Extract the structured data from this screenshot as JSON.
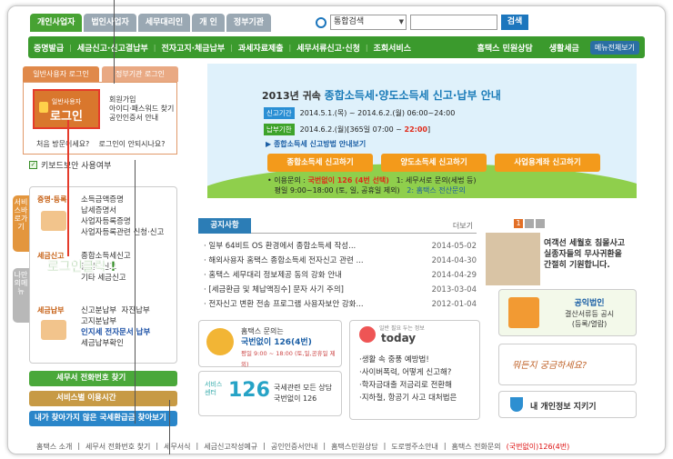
{
  "tabs": [
    "개인사업자",
    "법인사업자",
    "세무대리인",
    "개 인",
    "정부기관"
  ],
  "search": {
    "select": "통합검색",
    "button": "검색"
  },
  "nav": {
    "items": [
      "증명발급",
      "세금신고·신고결납부",
      "전자고지·체금납부",
      "과세자료제출",
      "세무서류신고·신청",
      "조회서비스"
    ],
    "right1": "홈택스 민원상담",
    "right2": "생활세금",
    "menu": "메뉴전체보기"
  },
  "login": {
    "tab1": "일반사용자 로그인",
    "tab2": "정부기관 로그인",
    "btn_small": "일반사용자",
    "btn_big": "로그인",
    "link1": "회원가입",
    "link2": "아이디·패스워드 찾기",
    "link3": "공인인증서 안내",
    "bot1": "처음 방문이세요?",
    "bot2": "로그인이 안되시나요?",
    "kbd": "키보드보안 사용여부"
  },
  "side": {
    "svc": "서비스바로가기",
    "my": "나만의메뉴"
  },
  "svc": [
    {
      "cat": "증명·등록",
      "items": [
        "소득금액증명",
        "납세증명서",
        "사업자등록증명",
        "사업자등록관련 신청·신고"
      ]
    },
    {
      "cat": "세금신고",
      "items": [
        "종합소득세신고",
        "원천세신고",
        "기타 세금신고"
      ]
    },
    {
      "cat": "세금납부",
      "items": [
        "신고분납부",
        "자진납부",
        "고지분납부",
        "인지세 전자문서 납부",
        "세금납부확인"
      ]
    }
  ],
  "annotation": "로그인클릭 !",
  "gbtns": [
    "세무서 전화번호 찾기",
    "서비스별 이용시간",
    "내가 찾아가지 않은 국세환급금 찾아보기"
  ],
  "banner": {
    "title_pre": "2013년 귀속",
    "title_main": "종합소득세·양도소득세 신고·납부 안내",
    "tag1": "신고기간",
    "period1": "2014.5.1.(목) ~ 2014.6.2.(월) 06:00~24:00",
    "tag2": "납부기한",
    "period2a": "2014.6.2.(월)[365일 07:00 ~",
    "period2b": "22:00",
    "period2c": "]",
    "guide": "▶ 종합소득세 신고방법 안내보기",
    "btn1": "종합소득세 신고하기",
    "btn2": "양도소득세 신고하기",
    "btn3": "사업용계좌 신고하기",
    "info1a": "• 이용문의 :",
    "info1b": "국번없이 126 (4번 선택)",
    "info1c": "1: 세무서로 문의(세법 등)",
    "info2": "평일 9:00~18:00 (토, 일, 공휴일 제외)",
    "info2b": "2: 홈택스 전산문의"
  },
  "notice": {
    "title": "공지사항",
    "more": "더보기",
    "rows": [
      [
        "일부 64비트 OS 환경에서 종합소득세 작성...",
        "2014-05-02"
      ],
      [
        "해외사용자 홈택스 종합소득세 전자신고 관련 ...",
        "2014-04-30"
      ],
      [
        "홈택스 세무대리 정보제공 동의 강화 안내",
        "2014-04-29"
      ],
      [
        "[세금환급 및 체납액징수] 문자 사기 주의]",
        "2013-03-04"
      ],
      [
        "전자신고 변환 전송 프로그램 사용자보안 강화...",
        "2012-01-04"
      ]
    ]
  },
  "call": {
    "t1": "홈택스 문의는",
    "t2": "국번없이 126(4번)",
    "t3": "평일 9:00 ~ 18:00 (토,일,공휴일 제외)"
  },
  "center": {
    "logo": "서비스센터",
    "num": "126",
    "t1": "국세관련 모든 상담",
    "t2": "국번없이 126"
  },
  "today": {
    "tag": "일반 필요 두는 정보",
    "logo": "today",
    "items": [
      "·생활 속 중풍 예방법!",
      "·사이버폭력, 어떻게 신고해?",
      "·학자금대출 저금리로 전환해",
      "·지하철, 항공기 사고 대처법은"
    ]
  },
  "right": {
    "banner1a": "여객선 세월호 침몰사고",
    "banner1b": "실종자들의 무사귀환을",
    "banner1c": "간절히 기원합니다.",
    "pub1": "공익법인",
    "pub2": "결산서류등 공시",
    "pub3": "(등록/열람)",
    "curious": "뭐든지 궁금하세요?",
    "privacy": "내 개인정보 지키기"
  },
  "footer": [
    "홈택스 소개",
    "세무서 전화번호 찾기",
    "세무서식",
    "세금신고작성예규",
    "공인인증서안내",
    "홈택스민원상담",
    "도로명주소안내",
    "홈택스 전화문의"
  ],
  "footer_red": "(국번없이)126(4번)",
  "colors": {
    "green": "#3b9a2d",
    "orange": "#e0894a",
    "blue": "#2c7db6",
    "red": "#e53b2b"
  }
}
